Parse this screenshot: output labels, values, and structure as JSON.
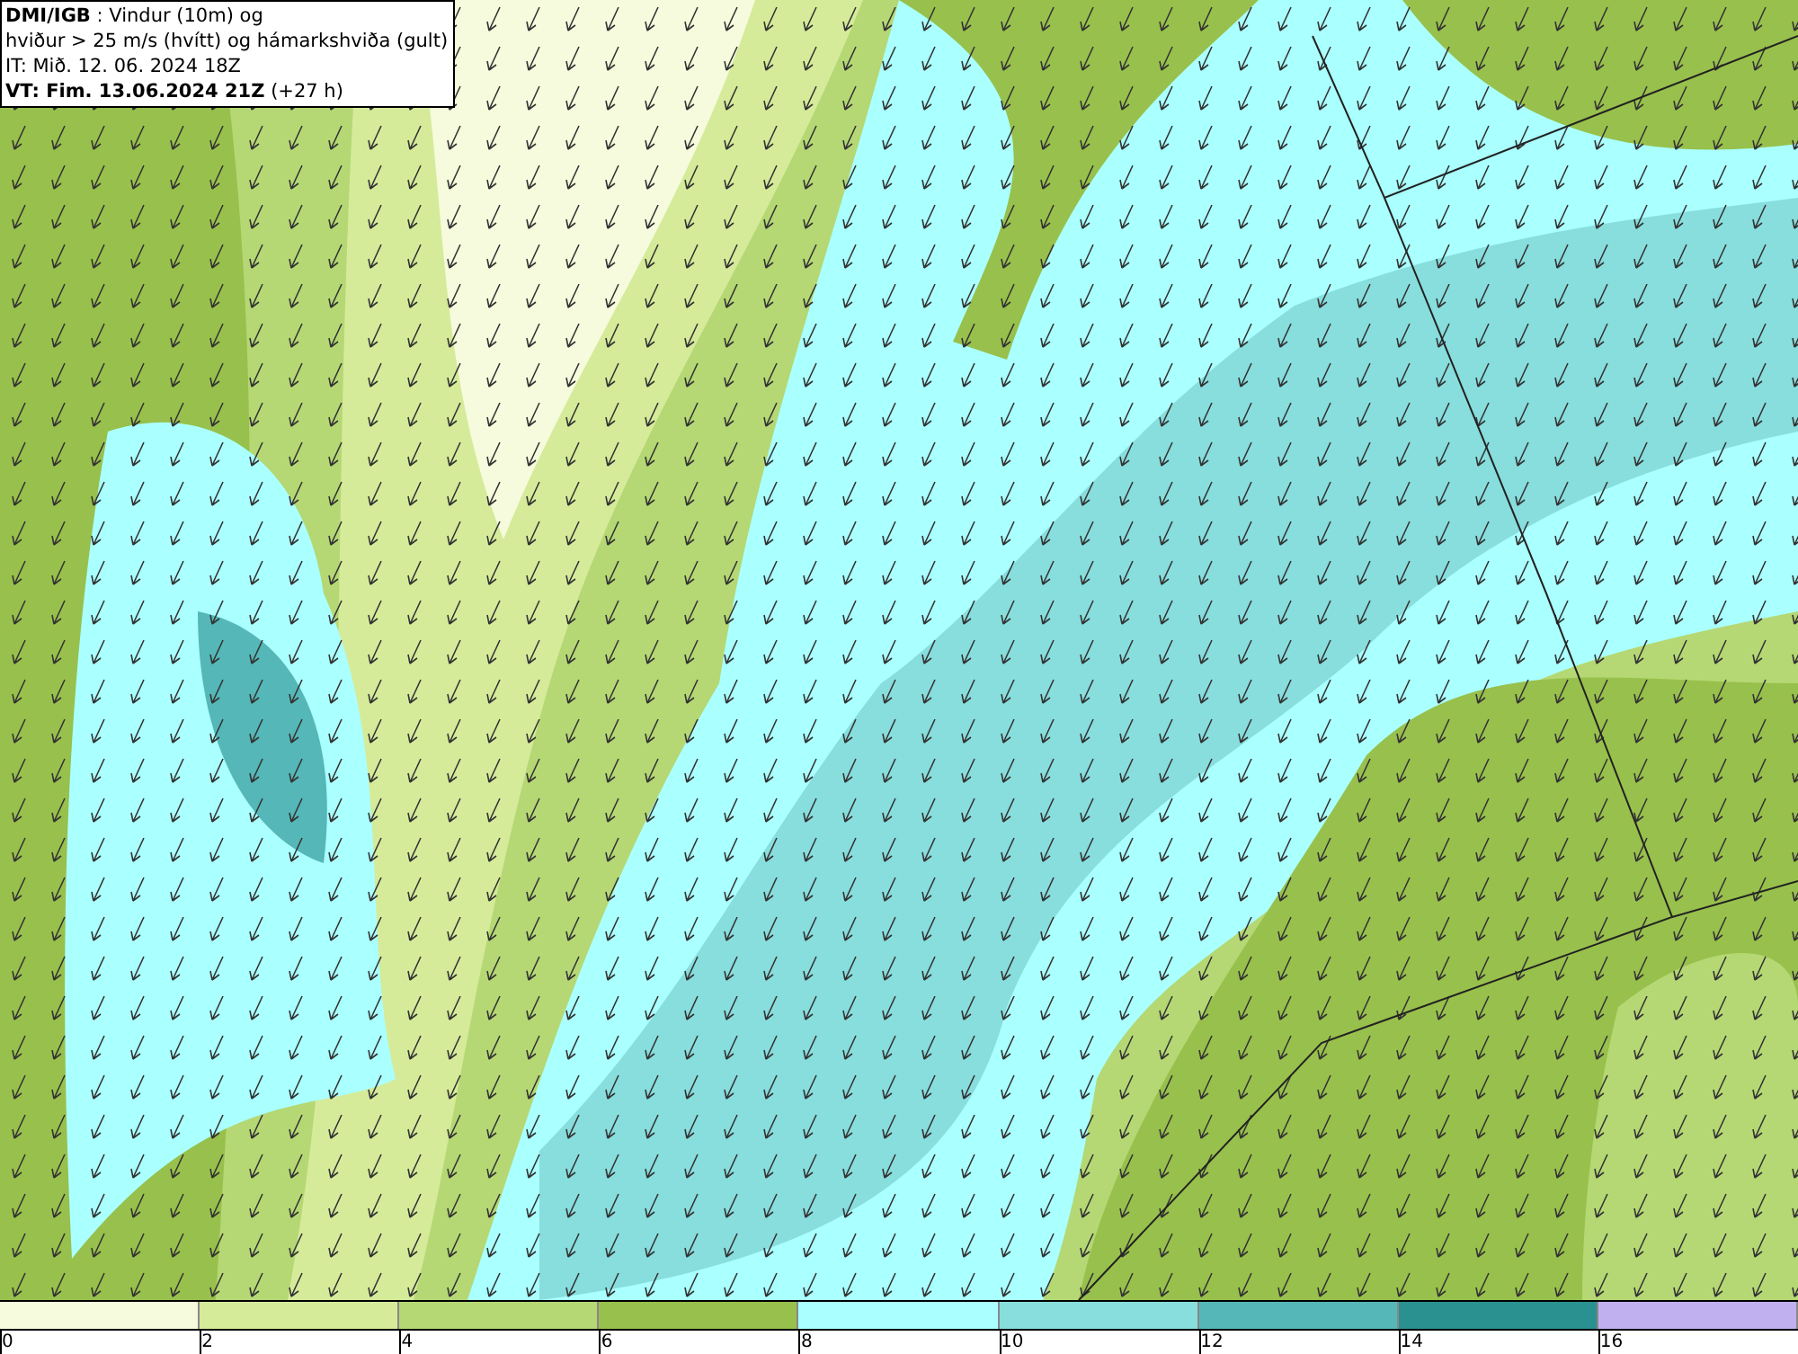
{
  "info": {
    "lines": [
      {
        "text": "**DMI/IGB** : Vindur (10m) og"
      },
      {
        "text": "hviður > 25 m/s (hvítt) og hámarkshviða (gult)"
      },
      {
        "text": "IT: Mið. 12. 06. 2024 18Z"
      },
      {
        "text": "**VT: Fim. 13.06.2024 21Z** (+27 h)"
      }
    ]
  },
  "colorbar": {
    "segments": [
      {
        "color": "#f5fbdc"
      },
      {
        "color": "#d5eb9a"
      },
      {
        "color": "#b5d874"
      },
      {
        "color": "#98c04c"
      },
      {
        "color": "#aaffff"
      },
      {
        "color": "#88dddd"
      },
      {
        "color": "#55b7b7"
      },
      {
        "color": "#2a9090"
      },
      {
        "color": "#c0b0f0"
      }
    ],
    "ticks": [
      "0",
      "2",
      "4",
      "6",
      "8",
      "10",
      "12",
      "14",
      "16"
    ]
  }
}
